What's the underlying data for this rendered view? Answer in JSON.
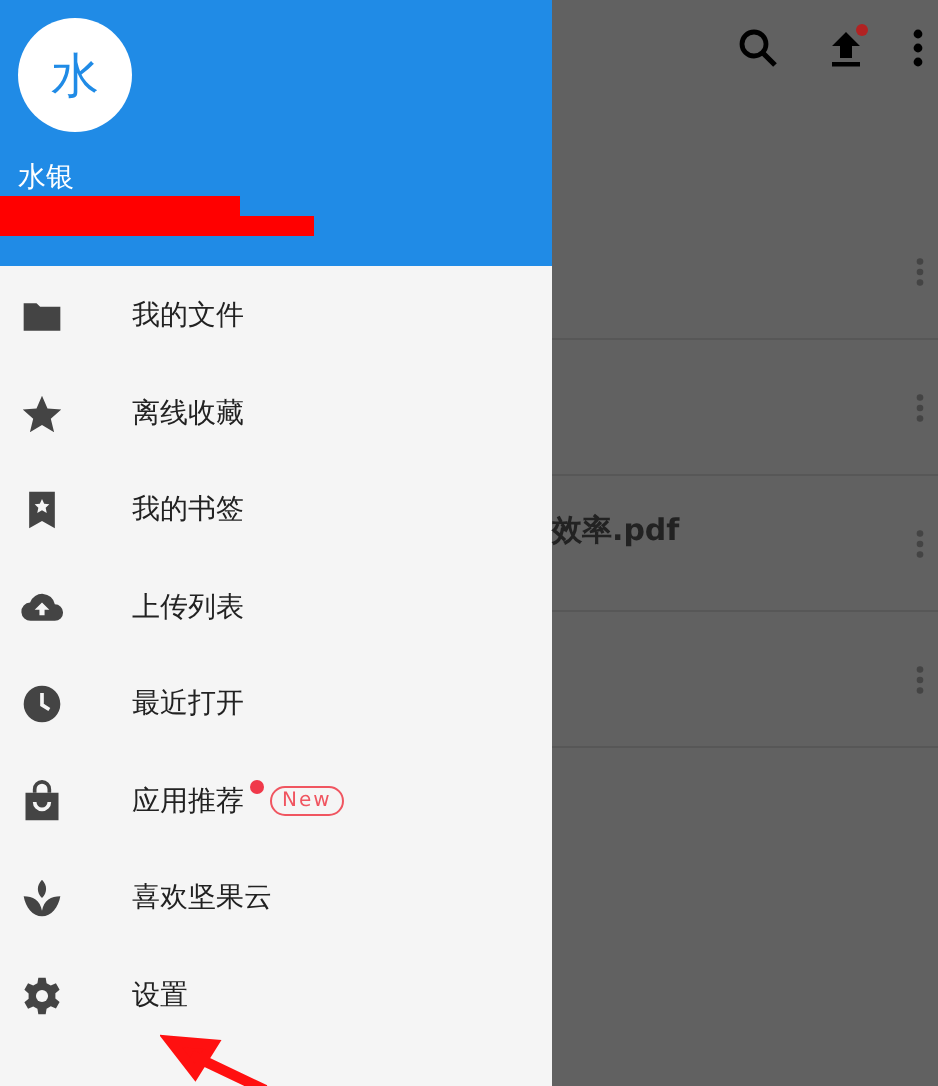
{
  "drawer": {
    "avatar_letter": "水",
    "user_name": "水银",
    "items": [
      {
        "kind": "folder",
        "label": "我的文件"
      },
      {
        "kind": "star",
        "label": "离线收藏"
      },
      {
        "kind": "bookmark",
        "label": "我的书签"
      },
      {
        "kind": "upload",
        "label": "上传列表"
      },
      {
        "kind": "clock",
        "label": "最近打开"
      },
      {
        "kind": "bag",
        "label": "应用推荐",
        "dot": true,
        "badge": "New"
      },
      {
        "kind": "leaf",
        "label": "喜欢坚果云"
      },
      {
        "kind": "gear",
        "label": "设置"
      }
    ]
  },
  "toolbar": {
    "upload_notification": true
  },
  "file_rows": [
    {
      "kind": "hidden"
    },
    {
      "kind": "hidden"
    },
    {
      "kind": "named",
      "name": "效率.pdf"
    },
    {
      "kind": "hidden"
    }
  ]
}
